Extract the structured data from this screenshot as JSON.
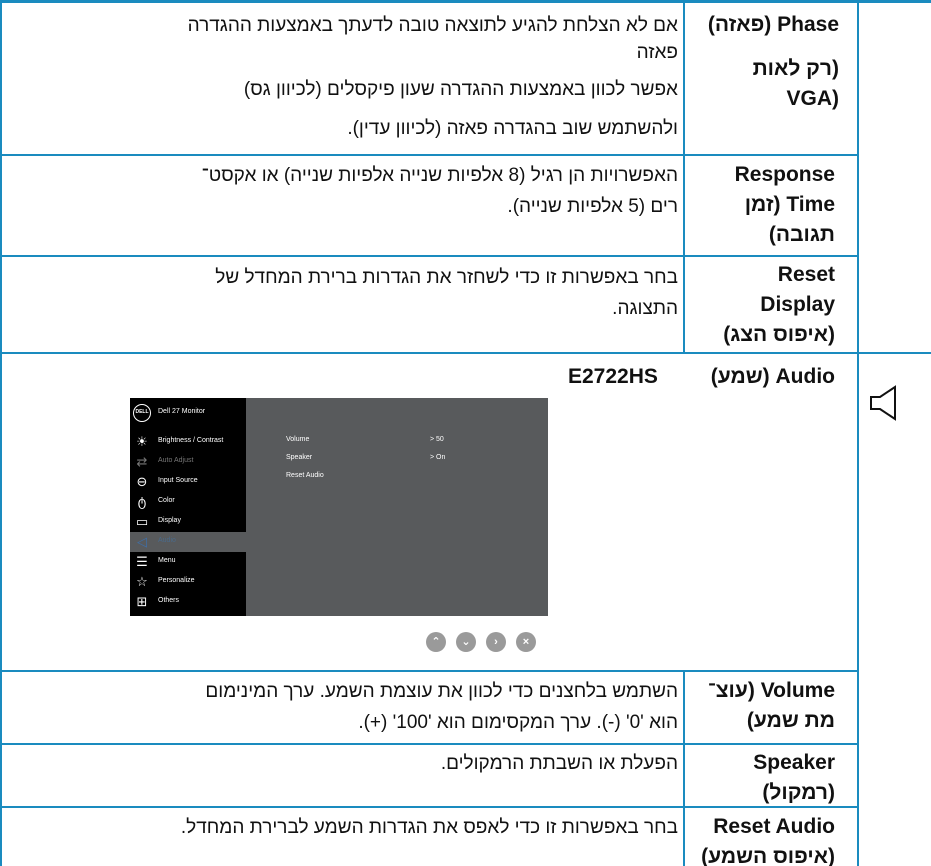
{
  "rows": {
    "phase": {
      "title_line1": "Phase (פאזה)",
      "title_line2": "(רק לאות",
      "title_line3": "VGA)",
      "desc_line1": "אם לא הצלחת להגיע לתוצאה טובה לדעתך באמצעות ההגדרה",
      "desc_line2": "פאזה",
      "desc_line3": "אפשר לכוון באמצעות ההגדרה שעון פיקסלים (לכיוון גס)",
      "desc_line4": "ולהשתמש שוב בהגדרה פאזה (לכיוון עדין)."
    },
    "response": {
      "title_line1": "Response",
      "title_line2": "Time (זמן",
      "title_line3": "תגובה)",
      "desc_line1": "האפשרויות הן רגיל (8 אלפיות שנייה אלפיות שנייה) או אקסט־",
      "desc_line2": "רים (5 אלפיות שנייה)."
    },
    "reset_display": {
      "title_line1": "Reset",
      "title_line2": "Display",
      "title_line3": "(איפוס הצג)",
      "desc_line1": "בחר באפשרות זו כדי לשחזר את הגדרות ברירת המחדל של",
      "desc_line2": "התצוגה."
    },
    "audio": {
      "title": "Audio (שמע)",
      "model": "E2722HS"
    },
    "volume": {
      "title_line1": "Volume (עוצ־",
      "title_line2": "מת שמע)",
      "desc_line1": "השתמש בלחצנים כדי לכוון את עוצמת השמע. ערך המינימום",
      "desc_line2": "הוא '0' (-). ערך המקסימום הוא '100' (+)."
    },
    "speaker": {
      "title_line1": "Speaker",
      "title_line2": "(רמקול)",
      "desc_line1": "הפעלת או השבתת הרמקולים."
    },
    "reset_audio": {
      "title_line1": "Reset Audio",
      "title_line2": "(איפוס השמע)",
      "desc_line1": "בחר באפשרות זו כדי לאפס את הגדרות השמע לברירת המחדל."
    }
  },
  "osd": {
    "logo": "DELL",
    "title": "Dell 27 Monitor",
    "menu": [
      {
        "label": "Brightness / Contrast",
        "icon": "brightness-icon"
      },
      {
        "label": "Auto Adjust",
        "icon": "auto-adjust-icon"
      },
      {
        "label": "Input Source",
        "icon": "input-source-icon"
      },
      {
        "label": "Color",
        "icon": "color-icon"
      },
      {
        "label": "Display",
        "icon": "display-icon"
      },
      {
        "label": "Audio",
        "icon": "audio-icon"
      },
      {
        "label": "Menu",
        "icon": "menu-icon"
      },
      {
        "label": "Personalize",
        "icon": "star-icon"
      },
      {
        "label": "Others",
        "icon": "others-icon"
      }
    ],
    "submenu": [
      {
        "label": "Volume",
        "value": "> 50"
      },
      {
        "label": "Speaker",
        "value": "> On"
      },
      {
        "label": "Reset Audio",
        "value": ""
      }
    ],
    "nav_buttons": [
      "up-button",
      "down-button",
      "right-button",
      "close-button"
    ]
  },
  "colors": {
    "grid": "#1a8bbf",
    "osd_bg": "#585a5c",
    "osd_menu_bg": "#000000",
    "nav_button": "#9a9a9a"
  }
}
